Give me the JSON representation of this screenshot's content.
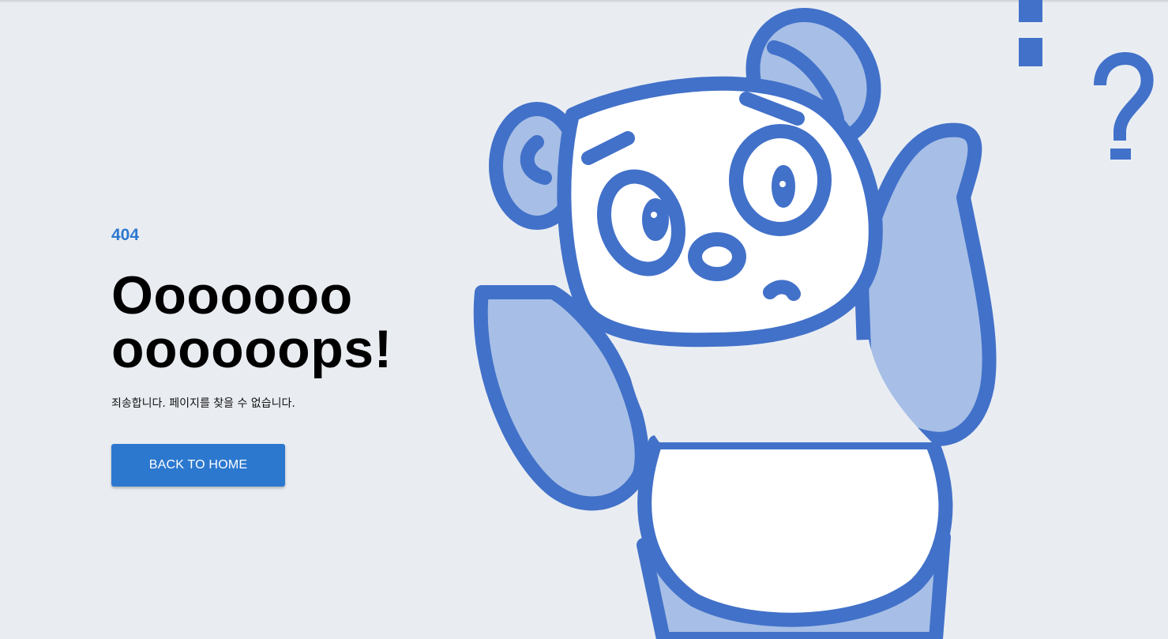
{
  "error": {
    "code": "404",
    "headline_line1": "Ooooooo",
    "headline_line2": "oooooops!",
    "message": "죄송합니다. 페이지를 찾을 수 없습니다."
  },
  "actions": {
    "back_home_label": "BACK TO HOME"
  },
  "colors": {
    "background": "#e9edf2",
    "accent": "#2c78cf",
    "panda_outline": "#4271c9",
    "panda_fill_light": "#a7bfe6"
  },
  "illustration": {
    "subject": "confused-panda",
    "marks": [
      "exclamation-mark",
      "question-mark"
    ]
  }
}
